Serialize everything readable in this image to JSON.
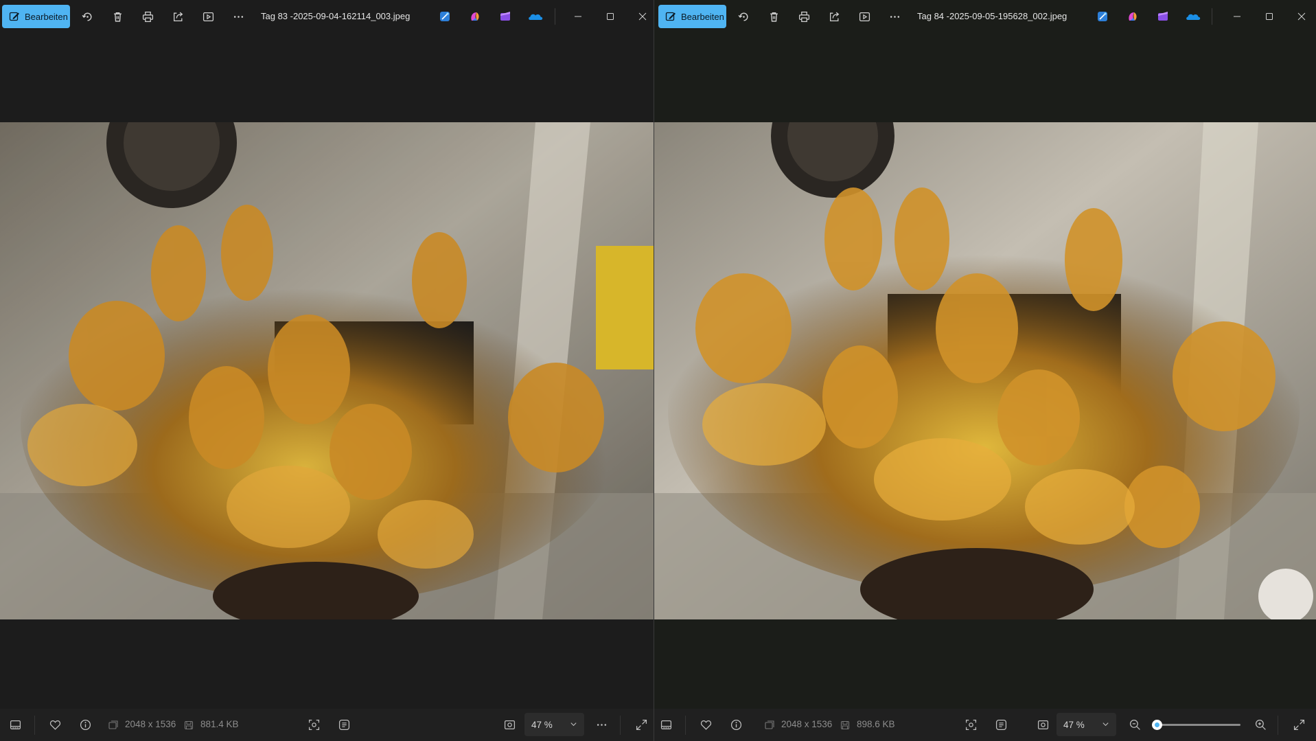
{
  "left": {
    "edit_label": "Bearbeiten",
    "filename": "Tag 83 -2025-09-04-162114_003.jpeg",
    "dimensions": "2048 x 1536",
    "file_size": "881.4 KB",
    "zoom": "47 %"
  },
  "right": {
    "edit_label": "Bearbeiten",
    "filename": "Tag 84 -2025-09-05-195628_002.jpeg",
    "dimensions": "2048 x 1536",
    "file_size": "898.6 KB",
    "zoom": "47 %",
    "zoom_slider_fraction": 0.05
  },
  "icons": {
    "toolbar": [
      "edit-icon",
      "rotate-icon",
      "delete-icon",
      "print-icon",
      "share-icon",
      "slideshow-icon",
      "more-icon"
    ],
    "apps": [
      "designer-app-icon",
      "copilot-app-icon",
      "clipchamp-app-icon",
      "onedrive-icon"
    ],
    "window": [
      "minimize-icon",
      "maximize-icon",
      "close-icon"
    ],
    "statusbar": [
      "filmstrip-icon",
      "favorite-icon",
      "info-icon",
      "image-dimensions-icon",
      "file-size-icon",
      "visual-search-icon",
      "text-recognition-icon",
      "fit-to-window-icon",
      "zoom-out-icon",
      "zoom-in-icon",
      "fullscreen-icon"
    ]
  },
  "colors": {
    "accent": "#4fb4f2",
    "background": "#1c1c1c",
    "statusbar": "#202020"
  }
}
